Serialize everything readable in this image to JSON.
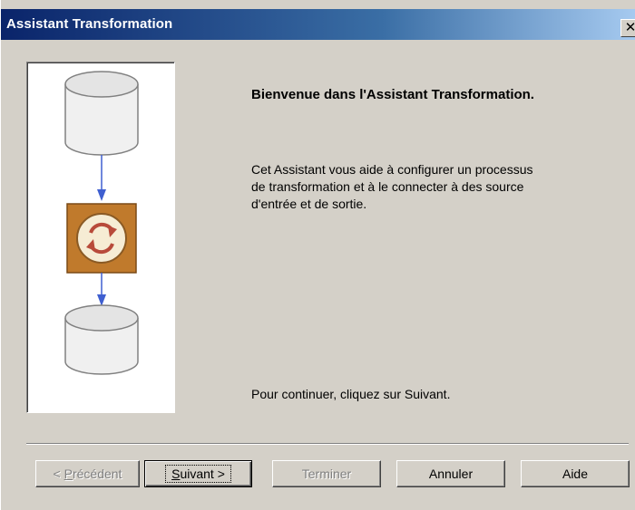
{
  "window": {
    "title": "Assistant Transformation",
    "close_label": "✕"
  },
  "illustration": {
    "icons": [
      "database-icon",
      "down-arrow-icon",
      "transform-process-icon",
      "down-arrow-icon",
      "database-icon"
    ],
    "colors": {
      "arrow": "#3f5fd0",
      "transform_box": "#c07a2c",
      "transform_circle": "#f6ecd4",
      "transform_arrows": "#b84a3a"
    }
  },
  "content": {
    "welcome_title": "Bienvenue dans l'Assistant Transformation.",
    "intro_lines": [
      "Cet Assistant vous aide à configurer un processus",
      "de transformation et à le connecter à des source",
      "d'entrée et de sortie."
    ],
    "continue_text": "Pour continuer, cliquez sur Suivant."
  },
  "buttons": {
    "previous": {
      "prefix": "< ",
      "mnemonic": "P",
      "rest": "récédent",
      "enabled": false
    },
    "next": {
      "mnemonic": "S",
      "rest": "uivant >",
      "enabled": true
    },
    "finish": {
      "label": "Terminer",
      "enabled": false
    },
    "cancel": {
      "label": "Annuler",
      "enabled": true
    },
    "help": {
      "label": "Aide",
      "enabled": true
    }
  }
}
